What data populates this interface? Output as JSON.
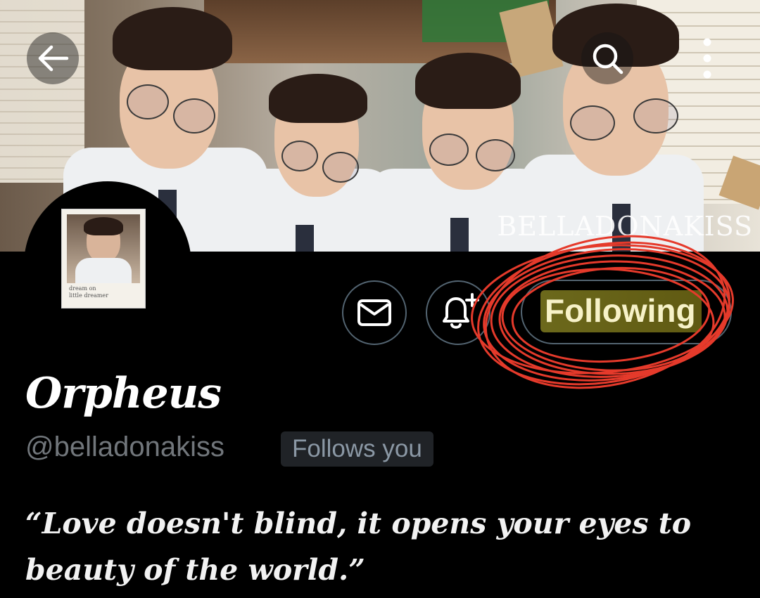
{
  "header": {
    "back_icon": "arrow-left-icon",
    "search_icon": "search-icon",
    "more_icon": "more-vertical-icon",
    "banner_watermark": "BELLADONAKISS"
  },
  "avatar": {
    "caption_line1": "dream on",
    "caption_line2": "little dreamer"
  },
  "actions": {
    "message_icon": "envelope-icon",
    "notify_icon": "bell-plus-icon",
    "following_label": "Following",
    "highlight_color": "#c4be32",
    "annotation_color": "#e53a2b"
  },
  "profile": {
    "display_name": "Orpheus",
    "handle": "@belladonakiss",
    "follows_you": "Follows you",
    "bio": "“Love doesn't blind, it opens your eyes to beauty of the world.”"
  }
}
